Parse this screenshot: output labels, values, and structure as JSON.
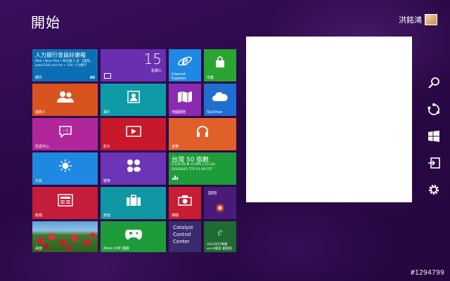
{
  "screen": {
    "title": "開始",
    "user_name": "洪銘鴻",
    "watermark": "#1294799"
  },
  "tiles": {
    "mail": {
      "headline": "人力銀行會員好康報",
      "body": "iPad / New iPad ! 每日抽 1 台 【還款... www.104.com.tw > 104 人力銀行",
      "label": "郵件",
      "count": "86",
      "color": "#0b6fb5"
    },
    "calendar": {
      "day": "15",
      "weekday": "星期三",
      "color": "#6a2fb0"
    },
    "ie": {
      "label": "Internet Explorer",
      "color": "#1e88e5"
    },
    "store": {
      "label": "市集",
      "color": "#2aa532"
    },
    "people": {
      "label": "連絡人",
      "color": "#d9531e"
    },
    "photos": {
      "label": "相片",
      "color": "#0f9ba6"
    },
    "maps": {
      "label": "地圖服務",
      "color": "#8a2bb0"
    },
    "skydrive": {
      "label": "SkyDrive",
      "color": "#1f6fd1"
    },
    "messaging": {
      "label": "訊息中心",
      "color": "#b0279c"
    },
    "video": {
      "label": "影片",
      "color": "#c7182c"
    },
    "music": {
      "label": "音樂",
      "color": "#e0602a"
    },
    "weather": {
      "label": "天氣",
      "color": "#1f88e0"
    },
    "sports": {
      "label": "體育",
      "color": "#6c34b6"
    },
    "finance": {
      "title": "台灣 50 指數",
      "line1": "5,129.03 ▼ -0.29% (-15.10)",
      "line2": "2012/8/15 下午 01:44 CST",
      "color": "#1f9c3a"
    },
    "news": {
      "label": "新聞",
      "color": "#c41c3b"
    },
    "travel": {
      "label": "旅遊",
      "color": "#0f97a3"
    },
    "camera": {
      "label": "相機",
      "color": "#c81d32"
    },
    "help": {
      "label": "說明",
      "color": "#4a1a78"
    },
    "desktop": {
      "label": "桌面",
      "color": "#4c7e2c"
    },
    "xbox": {
      "label": "Xbox LIVE 遊戲",
      "color": "#1f9c3a"
    },
    "catalyst": {
      "lines": [
        "Catalyst",
        "Control",
        "Center"
      ],
      "color": "#3a2a6e"
    },
    "excel": {
      "label": "2015年行事曆 excel檔案 最新版",
      "color": "#1e6b34"
    }
  },
  "charms": [
    "search-icon",
    "share-icon",
    "start-icon",
    "devices-icon",
    "settings-icon"
  ]
}
